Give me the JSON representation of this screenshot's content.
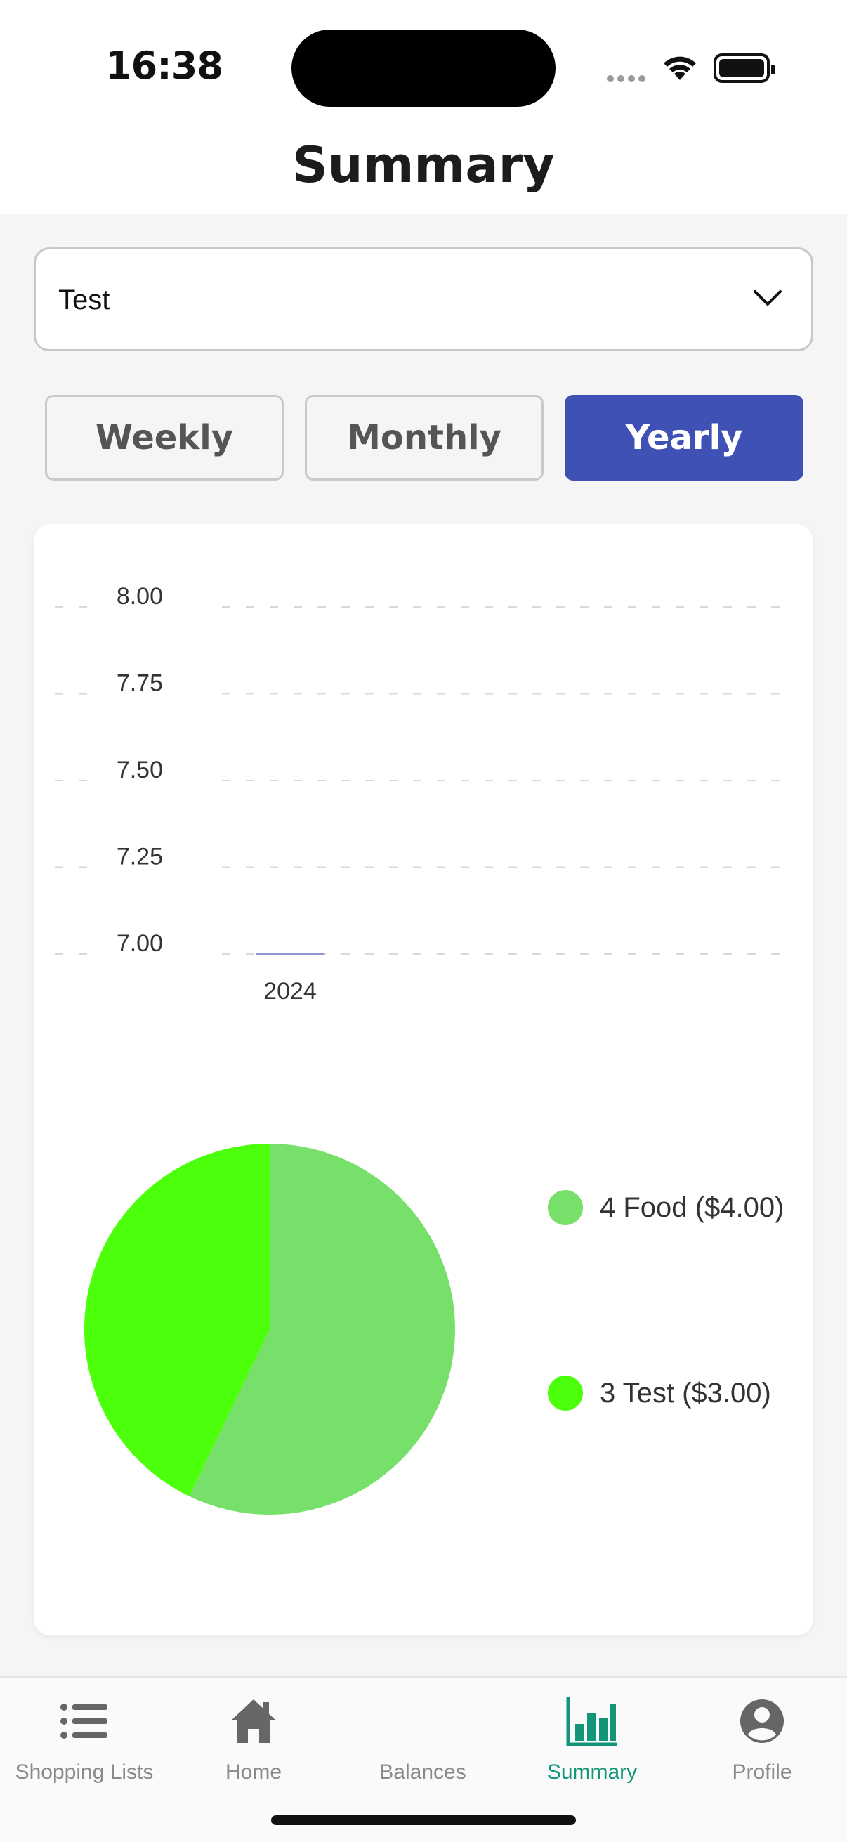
{
  "status_bar": {
    "time": "16:38"
  },
  "header": {
    "title": "Summary"
  },
  "group_select": {
    "value": "Test"
  },
  "periods": [
    {
      "label": "Weekly",
      "active": false
    },
    {
      "label": "Monthly",
      "active": false
    },
    {
      "label": "Yearly",
      "active": true
    }
  ],
  "colors": {
    "accent": "#3f51b5",
    "active_tab": "#139579",
    "food": "#77e06b",
    "test": "#4cff0b"
  },
  "chart_data": [
    {
      "type": "bar",
      "categories": [
        "2024"
      ],
      "values": [
        7.0
      ],
      "ylim": [
        7.0,
        8.0
      ],
      "yticks": [
        "8.00",
        "7.75",
        "7.50",
        "7.25",
        "7.00"
      ],
      "grid": true
    },
    {
      "type": "pie",
      "labels": [
        "4 Food ($4.00)",
        "3 Test ($3.00)"
      ],
      "values": [
        4,
        3
      ],
      "colors": [
        "#77e06b",
        "#4cff0b"
      ],
      "legend": "right"
    }
  ],
  "tabs": [
    {
      "label": "Shopping Lists",
      "icon": "list-icon"
    },
    {
      "label": "Home",
      "icon": "home-icon"
    },
    {
      "label": "Balances",
      "icon": "balances-icon"
    },
    {
      "label": "Summary",
      "icon": "bar-chart-icon",
      "active": true
    },
    {
      "label": "Profile",
      "icon": "profile-icon"
    }
  ]
}
